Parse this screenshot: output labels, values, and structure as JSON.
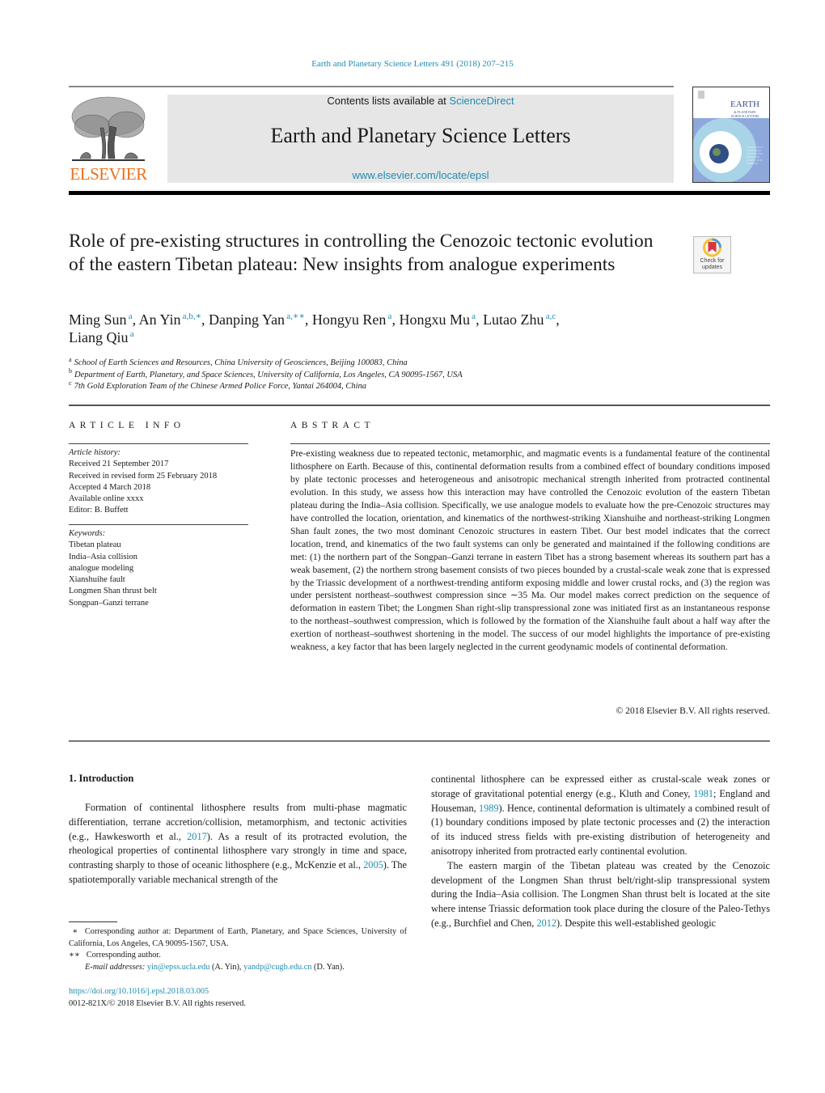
{
  "running_head": "Earth and Planetary Science Letters 491 (2018) 207–215",
  "masthead": {
    "publisher_logo_text": "ELSEVIER",
    "contents_prefix": "Contents lists available at ",
    "contents_link": "ScienceDirect",
    "journal_title": "Earth and Planetary Science Letters",
    "journal_url": "www.elsevier.com/locate/epsl",
    "cover_title": "EARTH",
    "cover_subtitle": "& PLANETARY SCIENCE LETTERS"
  },
  "article": {
    "title": "Role of pre-existing structures in controlling the Cenozoic tectonic evolution of the eastern Tibetan plateau: New insights from analogue experiments",
    "crossmark_label": "Check for updates",
    "authors": [
      {
        "name": "Ming Sun",
        "sup": "a",
        "sep": ", "
      },
      {
        "name": "An Yin",
        "sup": "a,b,∗",
        "sep": ", "
      },
      {
        "name": "Danping Yan",
        "sup": "a,∗∗",
        "sep": ", "
      },
      {
        "name": "Hongyu Ren",
        "sup": "a",
        "sep": ", "
      },
      {
        "name": "Hongxu Mu",
        "sup": "a",
        "sep": ", "
      },
      {
        "name": "Lutao Zhu",
        "sup": "a,c",
        "sep": ","
      },
      {
        "name": "Liang Qiu",
        "sup": "a",
        "sep": ""
      }
    ],
    "affiliations": [
      {
        "key": "a",
        "text": "School of Earth Sciences and Resources, China University of Geosciences, Beijing 100083, China"
      },
      {
        "key": "b",
        "text": "Department of Earth, Planetary, and Space Sciences, University of California, Los Angeles, CA 90095-1567, USA"
      },
      {
        "key": "c",
        "text": "7th Gold Exploration Team of the Chinese Armed Police Force, Yantai 264004, China"
      }
    ]
  },
  "article_info": {
    "heading": "ARTICLE INFO",
    "history_label": "Article history:",
    "history": [
      "Received 21 September 2017",
      "Received in revised form 25 February 2018",
      "Accepted 4 March 2018",
      "Available online xxxx",
      "Editor: B. Buffett"
    ],
    "keywords_label": "Keywords:",
    "keywords": [
      "Tibetan plateau",
      "India–Asia collision",
      "analogue modeling",
      "Xianshuihe fault",
      "Longmen Shan thrust belt",
      "Songpan–Ganzi terrane"
    ]
  },
  "abstract": {
    "heading": "ABSTRACT",
    "text": "Pre-existing weakness due to repeated tectonic, metamorphic, and magmatic events is a fundamental feature of the continental lithosphere on Earth. Because of this, continental deformation results from a combined effect of boundary conditions imposed by plate tectonic processes and heterogeneous and anisotropic mechanical strength inherited from protracted continental evolution. In this study, we assess how this interaction may have controlled the Cenozoic evolution of the eastern Tibetan plateau during the India–Asia collision. Specifically, we use analogue models to evaluate how the pre-Cenozoic structures may have controlled the location, orientation, and kinematics of the northwest-striking Xianshuihe and northeast-striking Longmen Shan fault zones, the two most dominant Cenozoic structures in eastern Tibet. Our best model indicates that the correct location, trend, and kinematics of the two fault systems can only be generated and maintained if the following conditions are met: (1) the northern part of the Songpan–Ganzi terrane in eastern Tibet has a strong basement whereas its southern part has a weak basement, (2) the northern strong basement consists of two pieces bounded by a crustal-scale weak zone that is expressed by the Triassic development of a northwest-trending antiform exposing middle and lower crustal rocks, and (3) the region was under persistent northeast–southwest compression since ∼35 Ma. Our model makes correct prediction on the sequence of deformation in eastern Tibet; the Longmen Shan right-slip transpressional zone was initiated first as an instantaneous response to the northeast–southwest compression, which is followed by the formation of the Xianshuihe fault about a half way after the exertion of northeast–southwest shortening in the model. The success of our model highlights the importance of pre-existing weakness, a key factor that has been largely neglected in the current geodynamic models of continental deformation.",
    "copyright": "© 2018 Elsevier B.V. All rights reserved."
  },
  "introduction": {
    "heading": "1. Introduction",
    "p1": {
      "t1": "Formation of continental lithosphere results from multi-phase magmatic differentiation, terrane accretion/collision, metamorphism, and tectonic activities (e.g., Hawkesworth et al., ",
      "ref1": "2017",
      "t2": "). As a result of its protracted evolution, the rheological properties of continental lithosphere vary strongly in time and space, contrasting sharply to those of oceanic lithosphere (e.g., McKenzie et al., ",
      "ref2": "2005",
      "t3": "). The spatiotemporally variable mechanical strength of the continental lithosphere can be expressed either as crustal-scale weak zones or storage of gravitational potential energy (e.g., Kluth and Coney, ",
      "ref3": "1981",
      "t4": "; England and Houseman, ",
      "ref4": "1989",
      "t5": "). Hence, continental deformation is ultimately a combined result of (1) boundary conditions imposed by plate tectonic processes and (2) the interaction of its induced stress fields with pre-existing distribution of heterogeneity and anisotropy inherited from protracted early continental evolution."
    },
    "p2": {
      "t1": "The eastern margin of the Tibetan plateau was created by the Cenozoic development of the Longmen Shan thrust belt/right-slip transpressional system during the India–Asia collision. The Longmen Shan thrust belt is located at the site where intense Triassic deformation took place during the closure of the Paleo-Tethys (e.g., Burchfiel and Chen, ",
      "ref1": "2012",
      "t2": "). Despite this well-established geologic"
    }
  },
  "footnotes": {
    "fn1_mark": "∗",
    "fn1_text": "Corresponding author at: Department of Earth, Planetary, and Space Sciences, University of California, Los Angeles, CA 90095-1567, USA.",
    "fn2_mark": "∗∗",
    "fn2_text": "Corresponding author.",
    "email_label": "E-mail addresses: ",
    "email1": "yin@epss.ucla.edu",
    "email1_who": " (A. Yin), ",
    "email2": "yandp@cugb.edu.cn",
    "email2_who": " (D. Yan)."
  },
  "doi": "https://doi.org/10.1016/j.epsl.2018.03.005",
  "issn_line": "0012-821X/© 2018 Elsevier B.V. All rights reserved.",
  "colors": {
    "link": "#1f8cb0",
    "elsevier_orange": "#e9711c",
    "masthead_bg": "#e6e6e6"
  }
}
